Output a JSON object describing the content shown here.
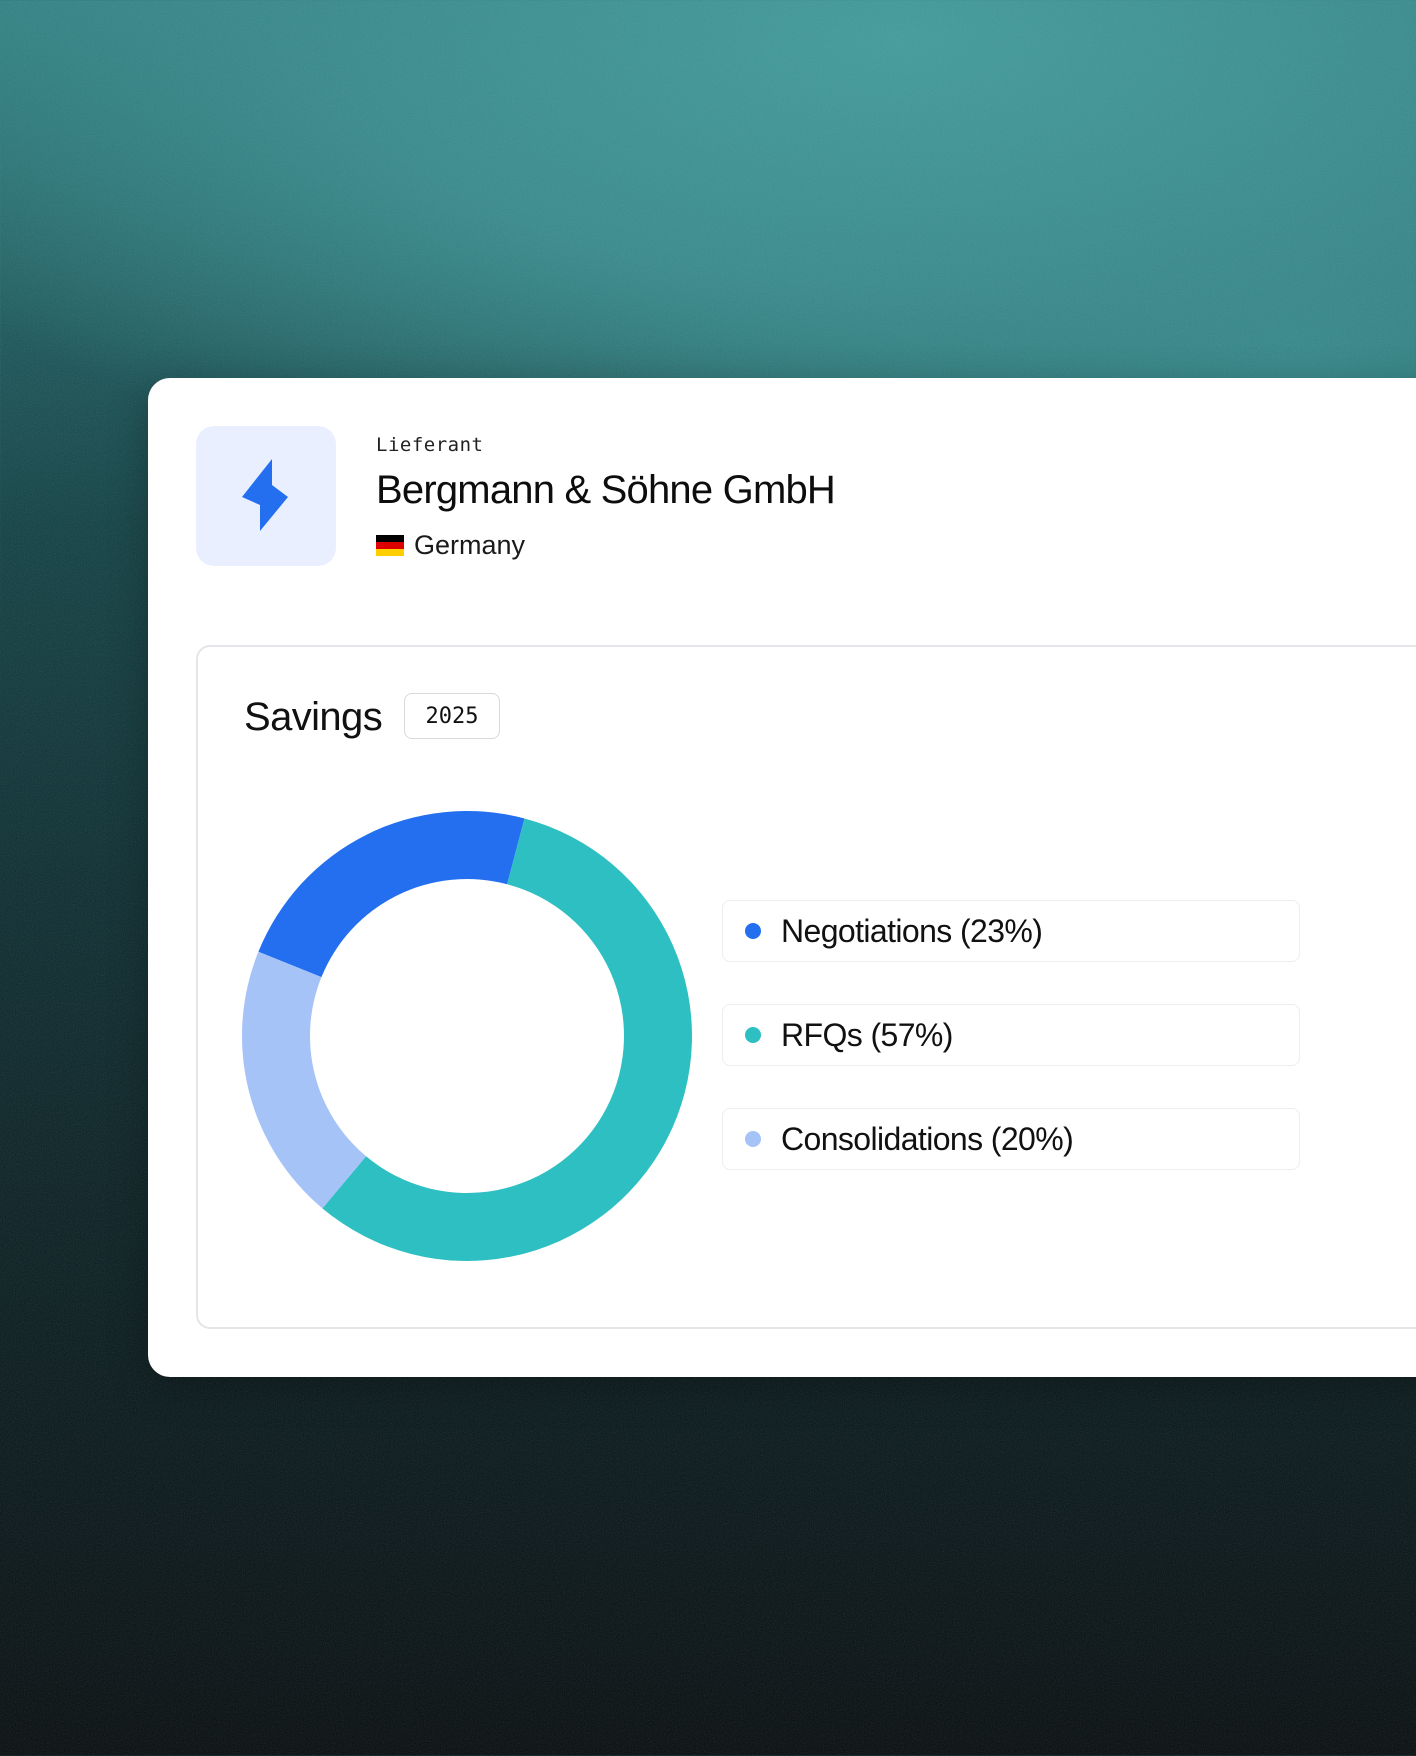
{
  "supplier": {
    "label": "Lieferant",
    "name": "Bergmann & Söhne GmbH",
    "country": "Germany",
    "logo_icon": "lightning-bolt-icon",
    "flag_colors": [
      "#000000",
      "#dd0000",
      "#ffce00"
    ]
  },
  "savings": {
    "title": "Savings",
    "year": "2025"
  },
  "colors": {
    "negotiations": "#236ff0",
    "rfqs": "#2ebfc2",
    "consolidations": "#a6c3f8",
    "accent": "#236ff0",
    "logo_bg": "#e9efff"
  },
  "chart_data": {
    "type": "pie",
    "donut": true,
    "categories": [
      "Negotiations",
      "RFQs",
      "Consolidations"
    ],
    "values": [
      23,
      57,
      20
    ],
    "legend": [
      "Negotiations (23%)",
      "RFQs (57%)",
      "Consolidations (20%)"
    ],
    "legend_position": "right"
  }
}
